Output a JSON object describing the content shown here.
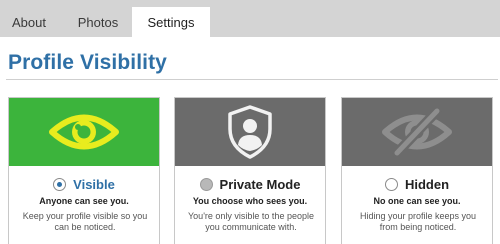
{
  "tabs": [
    {
      "label": "About"
    },
    {
      "label": "Photos"
    },
    {
      "label": "Settings",
      "active": true
    }
  ],
  "page_title": "Profile Visibility",
  "cards": [
    {
      "icon": "eye-icon",
      "banner_color": "#3cb43c",
      "option_label": "Visible",
      "selected": true,
      "subtitle": "Anyone can see you.",
      "description": "Keep your profile visible so you can be noticed."
    },
    {
      "icon": "shield-person-icon",
      "banner_color": "#6b6b6b",
      "option_label": "Private Mode",
      "selected": false,
      "subtitle": "You choose who sees you.",
      "description": "You're only visible to the people you communicate with."
    },
    {
      "icon": "eye-slash-icon",
      "banner_color": "#6b6b6b",
      "option_label": "Hidden",
      "selected": false,
      "subtitle": "No one can see you.",
      "description": "Hiding your profile keeps you from being noticed."
    }
  ],
  "colors": {
    "accent": "#2f70a6",
    "visible_green": "#3cb43c",
    "eye_yellow": "#e8ec1e",
    "grey_banner": "#6b6b6b",
    "tab_bar": "#d4d4d4"
  }
}
